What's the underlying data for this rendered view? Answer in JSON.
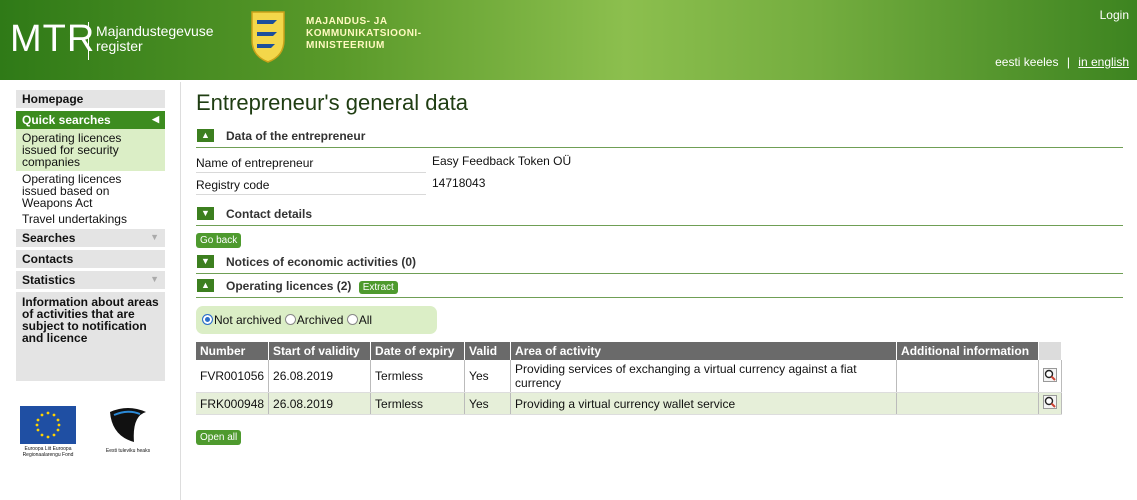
{
  "header": {
    "logo": "MTR",
    "logo_sub_1": "Majandustegevuse",
    "logo_sub_2": "register",
    "ministry_1": "MAJANDUS- JA",
    "ministry_2": "KOMMUNIKATSIOONI-",
    "ministry_3": "MINISTEERIUM",
    "login": "Login",
    "lang_et": "eesti keeles",
    "lang_sep": "|",
    "lang_en": "in english"
  },
  "sidebar": {
    "homepage": "Homepage",
    "quick_searches": "Quick searches",
    "sub_1": "Operating licences issued for security companies",
    "sub_2": "Operating licences issued based on Weapons Act",
    "sub_3": "Travel undertakings",
    "searches": "Searches",
    "contacts": "Contacts",
    "statistics": "Statistics",
    "info": "Information about areas of activities that are subject to notification and licence",
    "eu_logo_text": "Euroopa Liit Euroopa Regionaalarengu Fond",
    "ee_logo_text": "Eesti tuleviku heaks"
  },
  "main": {
    "title": "Entrepreneur's general data",
    "sec_entrepreneur": "Data of the entrepreneur",
    "name_label": "Name of entrepreneur",
    "name_value": "Easy Feedback Token OÜ",
    "code_label": "Registry code",
    "code_value": "14718043",
    "sec_contact": "Contact details",
    "go_back": "Go back",
    "sec_notices": "Notices of economic activities (0)",
    "sec_licences": "Operating licences (2)",
    "extract": "Extract",
    "radio_not_archived": "Not archived",
    "radio_archived": "Archived",
    "radio_all": "All",
    "open_all": "Open all"
  },
  "table": {
    "headers": [
      "Number",
      "Start of validity",
      "Date of expiry",
      "Valid",
      "Area of activity",
      "Additional information",
      ""
    ],
    "rows": [
      [
        "FVR001056",
        "26.08.2019",
        "Termless",
        "Yes",
        "Providing services of exchanging a virtual currency against a fiat currency",
        ""
      ],
      [
        "FRK000948",
        "26.08.2019",
        "Termless",
        "Yes",
        "Providing a virtual currency wallet service",
        ""
      ]
    ]
  },
  "colors": {
    "brand_green": "#3c8c1f",
    "light_green": "#dbeec6",
    "header_gray": "#6a6a6a"
  }
}
